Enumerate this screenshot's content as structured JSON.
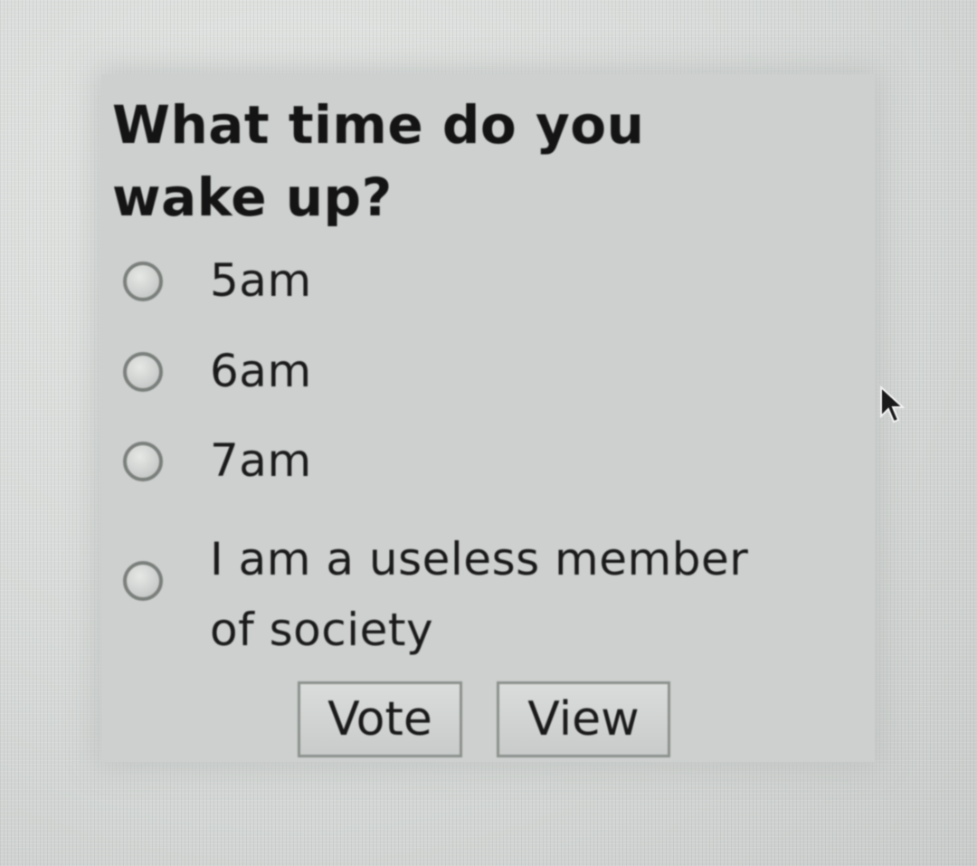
{
  "poll": {
    "question": "What time do you wake up?",
    "options": [
      {
        "label": "5am"
      },
      {
        "label": "6am"
      },
      {
        "label": "7am"
      },
      {
        "label": "I am a useless member of society"
      }
    ],
    "buttons": {
      "vote_label": "Vote",
      "view_label": "View"
    }
  },
  "icons": {
    "cursor": "mouse-pointer-icon",
    "radio": "radio-unchecked-icon"
  },
  "colors": {
    "background": "#d9dcda",
    "panel": "#cdd0ce",
    "text": "#141414",
    "radio_border": "#7b7f7c",
    "button_border": "#8d918e"
  }
}
